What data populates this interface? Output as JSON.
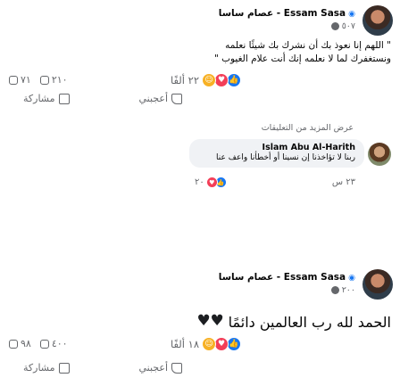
{
  "posts": [
    {
      "author": "Essam Sasa - عصام ساسا",
      "time": "٥٠٧",
      "text_line1": "\" اللهم إنا نعوذ بك أن نشرك بك شيئًا نعلمه",
      "text_line2": "ونستغفرك لما لا نعلمه إنك أنت علام الغيوب \"",
      "reaction_count": "٢٢ ألفًا",
      "comments_count": "٢١٠",
      "shares_count": "٧١",
      "like_label": "أعجبني",
      "share_label": "مشاركة",
      "view_more": "عرض المزيد من التعليقات",
      "comment": {
        "author": "Islam Abu Al-Harith",
        "text": "ربنا لا تؤاخذنا إن نسينا أو أخطأنا واعف عنا",
        "time": "٢٣ س",
        "reaction_count": "٢٠"
      }
    },
    {
      "author": "Essam Sasa - عصام ساسا",
      "time": "٢٠٠",
      "text": "الحمد لله رب العالمين دائمًا",
      "reaction_count": "١٨ ألفًا",
      "comments_count": "٤٠٠",
      "shares_count": "٩٨",
      "like_label": "أعجبني",
      "share_label": "مشاركة"
    }
  ],
  "colors": {
    "like": "#1877f2",
    "love": "#f33e58",
    "care": "#f7b125"
  }
}
